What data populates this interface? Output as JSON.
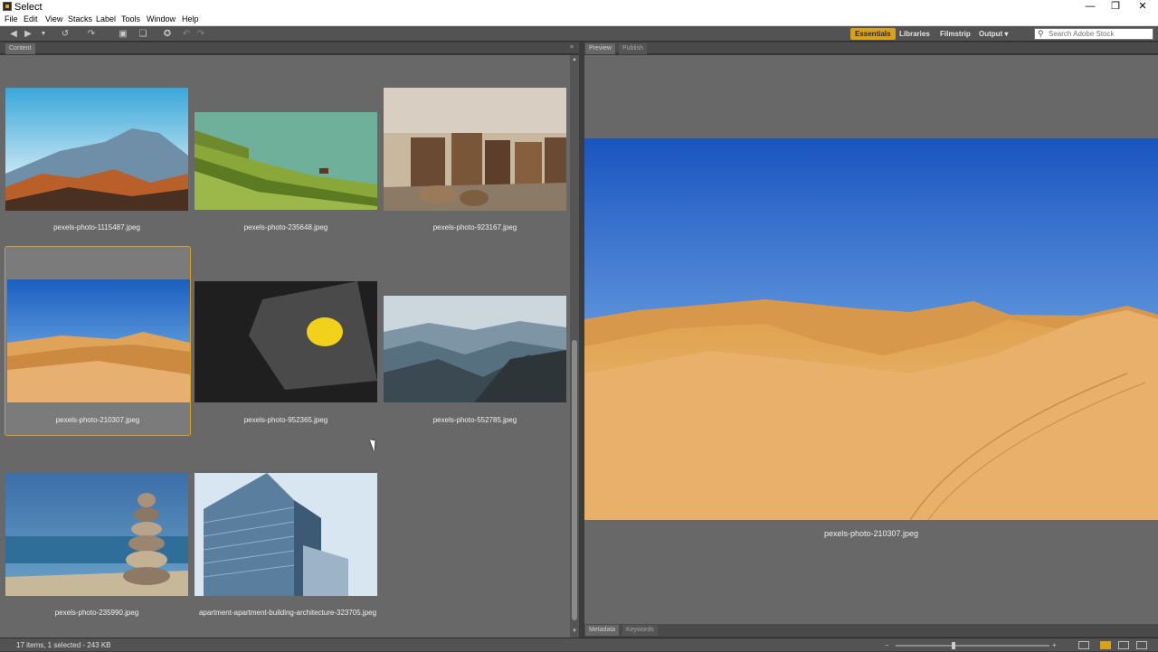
{
  "window": {
    "title": "Select",
    "minimize": "—",
    "restore": "❐",
    "close": "✕"
  },
  "menu": [
    "File",
    "Edit",
    "View",
    "Stacks",
    "Label",
    "Tools",
    "Window",
    "Help"
  ],
  "toolbar": {
    "icons": [
      "back-arrow-icon",
      "forward-arrow-icon",
      "dropdown-icon",
      "boomerang-icon",
      "rotate-icon",
      "camera-import-icon",
      "stack-icon",
      "refine-icon",
      "undo-icon",
      "redo-icon"
    ],
    "workspaces": [
      "Essentials",
      "Libraries",
      "Filmstrip",
      "Output ▾"
    ],
    "active_workspace": "Essentials",
    "search_placeholder": "Search Adobe Stock"
  },
  "content_panel": {
    "tab": "Content"
  },
  "preview_panel": {
    "tabs": [
      "Preview",
      "Publish"
    ],
    "filename": "pexels-photo-210307.jpeg"
  },
  "bottom_panel": {
    "tabs": [
      "Metadata",
      "Keywords"
    ]
  },
  "thumbnails": [
    {
      "name": "pexels-photo-1115487.jpeg",
      "scene": "mountain"
    },
    {
      "name": "pexels-photo-235648.jpeg",
      "scene": "terraces"
    },
    {
      "name": "pexels-photo-923167.jpeg",
      "scene": "logs"
    },
    {
      "name": "pexels-photo-210307.jpeg",
      "scene": "desert",
      "selected": true
    },
    {
      "name": "pexels-photo-952365.jpeg",
      "scene": "lemon"
    },
    {
      "name": "pexels-photo-552785.jpeg",
      "scene": "valley"
    },
    {
      "name": "pexels-photo-235990.jpeg",
      "scene": "stones"
    },
    {
      "name": "apartment-apartment-building-architecture-323705.jpeg",
      "scene": "building"
    }
  ],
  "status": {
    "text": "17 items, 1 selected - 243 KB"
  },
  "colors": {
    "accent": "#d9a11a",
    "panel": "#686868",
    "chrome": "#535353"
  }
}
